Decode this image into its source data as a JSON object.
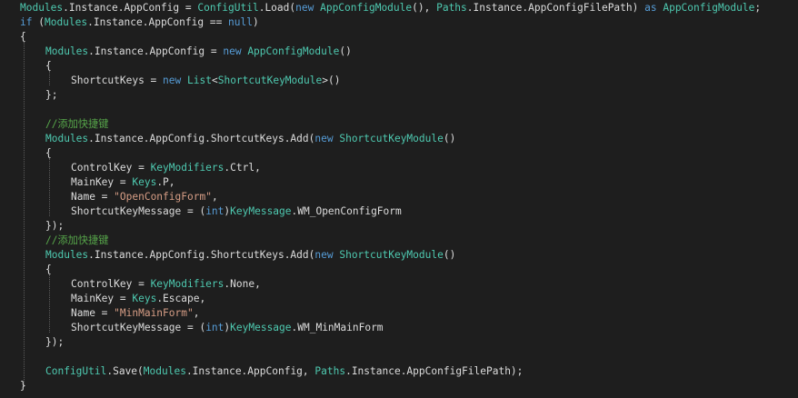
{
  "colors": {
    "background": "#1e1e1e",
    "text": "#dcdcdc",
    "type": "#4ec9b0",
    "keyword": "#569cd6",
    "string": "#d69d85",
    "comment": "#57a64a",
    "guide": "#5a5a5a"
  },
  "code_lines": [
    {
      "indent": 2,
      "tokens": [
        {
          "t": "Modules",
          "c": "type"
        },
        {
          "t": ".Instance.AppConfig = ",
          "c": "id"
        },
        {
          "t": "ConfigUtil",
          "c": "type"
        },
        {
          "t": ".Load(",
          "c": "id"
        },
        {
          "t": "new",
          "c": "kw"
        },
        {
          "t": " ",
          "c": "id"
        },
        {
          "t": "AppConfigModule",
          "c": "type"
        },
        {
          "t": "(), ",
          "c": "id"
        },
        {
          "t": "Paths",
          "c": "type"
        },
        {
          "t": ".Instance.AppConfigFilePath) ",
          "c": "id"
        },
        {
          "t": "as",
          "c": "kw"
        },
        {
          "t": " ",
          "c": "id"
        },
        {
          "t": "AppConfigModule",
          "c": "type"
        },
        {
          "t": ";",
          "c": "id"
        }
      ]
    },
    {
      "indent": 2,
      "tokens": [
        {
          "t": "if",
          "c": "kw"
        },
        {
          "t": " (",
          "c": "id"
        },
        {
          "t": "Modules",
          "c": "type"
        },
        {
          "t": ".Instance.AppConfig == ",
          "c": "id"
        },
        {
          "t": "null",
          "c": "kw"
        },
        {
          "t": ")",
          "c": "id"
        }
      ]
    },
    {
      "indent": 2,
      "tokens": [
        {
          "t": "{",
          "c": "id"
        }
      ]
    },
    {
      "indent": 6,
      "tokens": [
        {
          "t": "Modules",
          "c": "type"
        },
        {
          "t": ".Instance.AppConfig = ",
          "c": "id"
        },
        {
          "t": "new",
          "c": "kw"
        },
        {
          "t": " ",
          "c": "id"
        },
        {
          "t": "AppConfigModule",
          "c": "type"
        },
        {
          "t": "()",
          "c": "id"
        }
      ]
    },
    {
      "indent": 6,
      "tokens": [
        {
          "t": "{",
          "c": "id"
        }
      ]
    },
    {
      "indent": 10,
      "tokens": [
        {
          "t": "ShortcutKeys = ",
          "c": "id"
        },
        {
          "t": "new",
          "c": "kw"
        },
        {
          "t": " ",
          "c": "id"
        },
        {
          "t": "List",
          "c": "type"
        },
        {
          "t": "<",
          "c": "id"
        },
        {
          "t": "ShortcutKeyModule",
          "c": "type"
        },
        {
          "t": ">()",
          "c": "id"
        }
      ]
    },
    {
      "indent": 6,
      "tokens": [
        {
          "t": "};",
          "c": "id"
        }
      ]
    },
    {
      "indent": 6,
      "tokens": []
    },
    {
      "indent": 6,
      "tokens": [
        {
          "t": "//添加快捷键",
          "c": "cmt"
        }
      ]
    },
    {
      "indent": 6,
      "tokens": [
        {
          "t": "Modules",
          "c": "type"
        },
        {
          "t": ".Instance.AppConfig.ShortcutKeys.Add(",
          "c": "id"
        },
        {
          "t": "new",
          "c": "kw"
        },
        {
          "t": " ",
          "c": "id"
        },
        {
          "t": "ShortcutKeyModule",
          "c": "type"
        },
        {
          "t": "()",
          "c": "id"
        }
      ]
    },
    {
      "indent": 6,
      "tokens": [
        {
          "t": "{",
          "c": "id"
        }
      ]
    },
    {
      "indent": 10,
      "tokens": [
        {
          "t": "ControlKey = ",
          "c": "id"
        },
        {
          "t": "KeyModifiers",
          "c": "type"
        },
        {
          "t": ".Ctrl,",
          "c": "id"
        }
      ]
    },
    {
      "indent": 10,
      "tokens": [
        {
          "t": "MainKey = ",
          "c": "id"
        },
        {
          "t": "Keys",
          "c": "type"
        },
        {
          "t": ".P,",
          "c": "id"
        }
      ]
    },
    {
      "indent": 10,
      "tokens": [
        {
          "t": "Name = ",
          "c": "id"
        },
        {
          "t": "\"OpenConfigForm\"",
          "c": "str"
        },
        {
          "t": ",",
          "c": "id"
        }
      ]
    },
    {
      "indent": 10,
      "tokens": [
        {
          "t": "ShortcutKeyMessage = (",
          "c": "id"
        },
        {
          "t": "int",
          "c": "kw"
        },
        {
          "t": ")",
          "c": "id"
        },
        {
          "t": "KeyMessage",
          "c": "type"
        },
        {
          "t": ".WM_OpenConfigForm",
          "c": "id"
        }
      ]
    },
    {
      "indent": 6,
      "tokens": [
        {
          "t": "});",
          "c": "id"
        }
      ]
    },
    {
      "indent": 6,
      "tokens": [
        {
          "t": "//添加快捷键",
          "c": "cmt"
        }
      ]
    },
    {
      "indent": 6,
      "tokens": [
        {
          "t": "Modules",
          "c": "type"
        },
        {
          "t": ".Instance.AppConfig.ShortcutKeys.Add(",
          "c": "id"
        },
        {
          "t": "new",
          "c": "kw"
        },
        {
          "t": " ",
          "c": "id"
        },
        {
          "t": "ShortcutKeyModule",
          "c": "type"
        },
        {
          "t": "()",
          "c": "id"
        }
      ]
    },
    {
      "indent": 6,
      "tokens": [
        {
          "t": "{",
          "c": "id"
        }
      ]
    },
    {
      "indent": 10,
      "tokens": [
        {
          "t": "ControlKey = ",
          "c": "id"
        },
        {
          "t": "KeyModifiers",
          "c": "type"
        },
        {
          "t": ".None,",
          "c": "id"
        }
      ]
    },
    {
      "indent": 10,
      "tokens": [
        {
          "t": "MainKey = ",
          "c": "id"
        },
        {
          "t": "Keys",
          "c": "type"
        },
        {
          "t": ".Escape,",
          "c": "id"
        }
      ]
    },
    {
      "indent": 10,
      "tokens": [
        {
          "t": "Name = ",
          "c": "id"
        },
        {
          "t": "\"MinMainForm\"",
          "c": "str"
        },
        {
          "t": ",",
          "c": "id"
        }
      ]
    },
    {
      "indent": 10,
      "tokens": [
        {
          "t": "ShortcutKeyMessage = (",
          "c": "id"
        },
        {
          "t": "int",
          "c": "kw"
        },
        {
          "t": ")",
          "c": "id"
        },
        {
          "t": "KeyMessage",
          "c": "type"
        },
        {
          "t": ".WM_MinMainForm",
          "c": "id"
        }
      ]
    },
    {
      "indent": 6,
      "tokens": [
        {
          "t": "});",
          "c": "id"
        }
      ]
    },
    {
      "indent": 6,
      "tokens": []
    },
    {
      "indent": 6,
      "tokens": [
        {
          "t": "ConfigUtil",
          "c": "type"
        },
        {
          "t": ".Save(",
          "c": "id"
        },
        {
          "t": "Modules",
          "c": "type"
        },
        {
          "t": ".Instance.AppConfig, ",
          "c": "id"
        },
        {
          "t": "Paths",
          "c": "type"
        },
        {
          "t": ".Instance.AppConfigFilePath);",
          "c": "id"
        }
      ]
    },
    {
      "indent": 2,
      "tokens": [
        {
          "t": "}",
          "c": "id"
        }
      ]
    }
  ]
}
